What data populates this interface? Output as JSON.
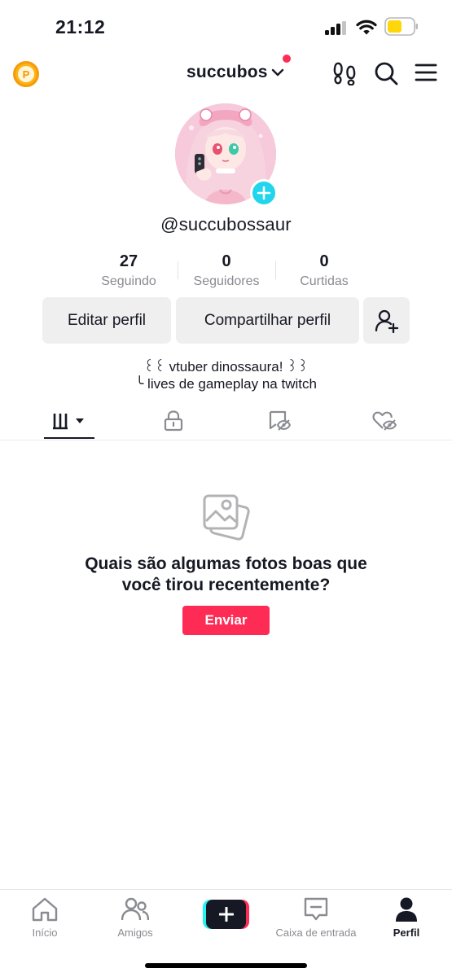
{
  "status_bar": {
    "time": "21:12",
    "icons": [
      "signal-icon",
      "wifi-icon",
      "battery-icon"
    ],
    "battery_color": "#ffd60a"
  },
  "top_nav": {
    "coin_letter": "P",
    "username": "succubos",
    "icons": [
      "footprint-icon",
      "search-icon",
      "menu-icon"
    ],
    "notification_dot_color": "#fe2c55"
  },
  "profile": {
    "handle": "@succubossaur",
    "stats": [
      {
        "value": "27",
        "label": "Seguindo"
      },
      {
        "value": "0",
        "label": "Seguidores"
      },
      {
        "value": "0",
        "label": "Curtidas"
      }
    ],
    "buttons": {
      "edit": "Editar perfil",
      "share": "Compartilhar perfil"
    },
    "bio": [
      "꒰꒰ vtuber dinossaura! ꒱꒱",
      "╰ lives de gameplay na twitch"
    ]
  },
  "tabs": {
    "icons": [
      "grid-icon",
      "lock-icon",
      "tagged-icon",
      "liked-hidden-icon"
    ],
    "active": "grid-icon"
  },
  "empty_state": {
    "title_line1": "Quais são algumas fotos boas que",
    "title_line2": "você tirou recentemente?",
    "button": "Enviar"
  },
  "bottom_nav": {
    "items": [
      {
        "label": "Início",
        "icon": "home-icon"
      },
      {
        "label": "Amigos",
        "icon": "friends-icon"
      },
      {
        "label": "",
        "icon": "create-icon"
      },
      {
        "label": "Caixa de entrada",
        "icon": "inbox-icon"
      },
      {
        "label": "Perfil",
        "icon": "profile-icon"
      }
    ],
    "active": "Perfil"
  },
  "colors": {
    "accent": "#fe2c55",
    "cyan": "#20d5ec",
    "text": "#161823",
    "muted": "#8a8b91",
    "button_bg": "#efefef"
  }
}
